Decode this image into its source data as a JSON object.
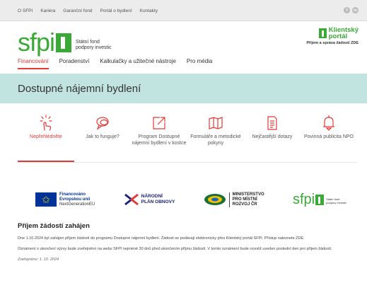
{
  "top_nav": [
    "O SFPI",
    "Kariéra",
    "Garanční fond",
    "Portál o bydlení",
    "Kontakty"
  ],
  "social_icons": [
    "facebook-icon",
    "linkedin-icon"
  ],
  "logo": {
    "wordmark": "sfpi",
    "line1": "Státní fond",
    "line2": "podpory investic"
  },
  "klientsky_portal": {
    "line1": "Klientský",
    "line2": "portál",
    "subtitle": "Příjem a správa žádostí ZDE"
  },
  "main_nav": [
    {
      "label": "Financování",
      "active": true
    },
    {
      "label": "Poradenství",
      "active": false
    },
    {
      "label": "Kalkulačky a užitečné nástroje",
      "active": false
    },
    {
      "label": "Pro média",
      "active": false
    }
  ],
  "hero": {
    "title": "Dostupné nájemní bydlení"
  },
  "tiles": [
    {
      "label": "Nepřehlédněte",
      "icon": "pointer-click-icon",
      "active": true
    },
    {
      "label": "Jak to funguje?",
      "icon": "chat-bubbles-icon",
      "active": false
    },
    {
      "label": "Program Dostupné nájemní bydlení v kostce",
      "icon": "external-link-icon",
      "active": false
    },
    {
      "label": "Formuláře a metodické pokyny",
      "icon": "map-icon",
      "active": false
    },
    {
      "label": "Nejčastější dotazy",
      "icon": "document-icon",
      "active": false
    },
    {
      "label": "Povinná publicita NPO",
      "icon": "bell-icon",
      "active": false
    }
  ],
  "partners": {
    "eu": {
      "line1": "Financováno",
      "line2": "Evropskou unií",
      "line3": "NextGenerationEU"
    },
    "npo": {
      "line1": "NÁRODNÍ",
      "line2": "PLÁN OBNOVY"
    },
    "mmr": {
      "line1": "MINISTERSTVO",
      "line2": "PRO MÍSTNÍ",
      "line3": "ROZVOJ ČR"
    },
    "sfpi": {
      "wordmark": "sfpi",
      "line1": "Státní fond",
      "line2": "podpory investic"
    }
  },
  "news": {
    "title": "Příjem žádostí zahájen",
    "p1": "Dne 1.10.2024 byl zahájen příjem žádostí do programu Dostupné nájemní bydlení. Žádosti se podávají elektronicky přes Klientský portál SFPI. Přístup naleznete ZDE.",
    "p2": "Oznámení o ukončení výzvy bude zveřejněno na webu SFPI nejméně 30 dnů před ukončením příjmu žádostí. V tomto oznámení bude rovněž uveden poslední den pro příjem žádostí.",
    "date": "Zveřejněno: 1. 10. 2024"
  },
  "colors": {
    "brand_green": "#3aa935",
    "accent_red": "#e53935",
    "hero_bg": "#c2e4e1",
    "topbar_bg": "#ececec"
  }
}
